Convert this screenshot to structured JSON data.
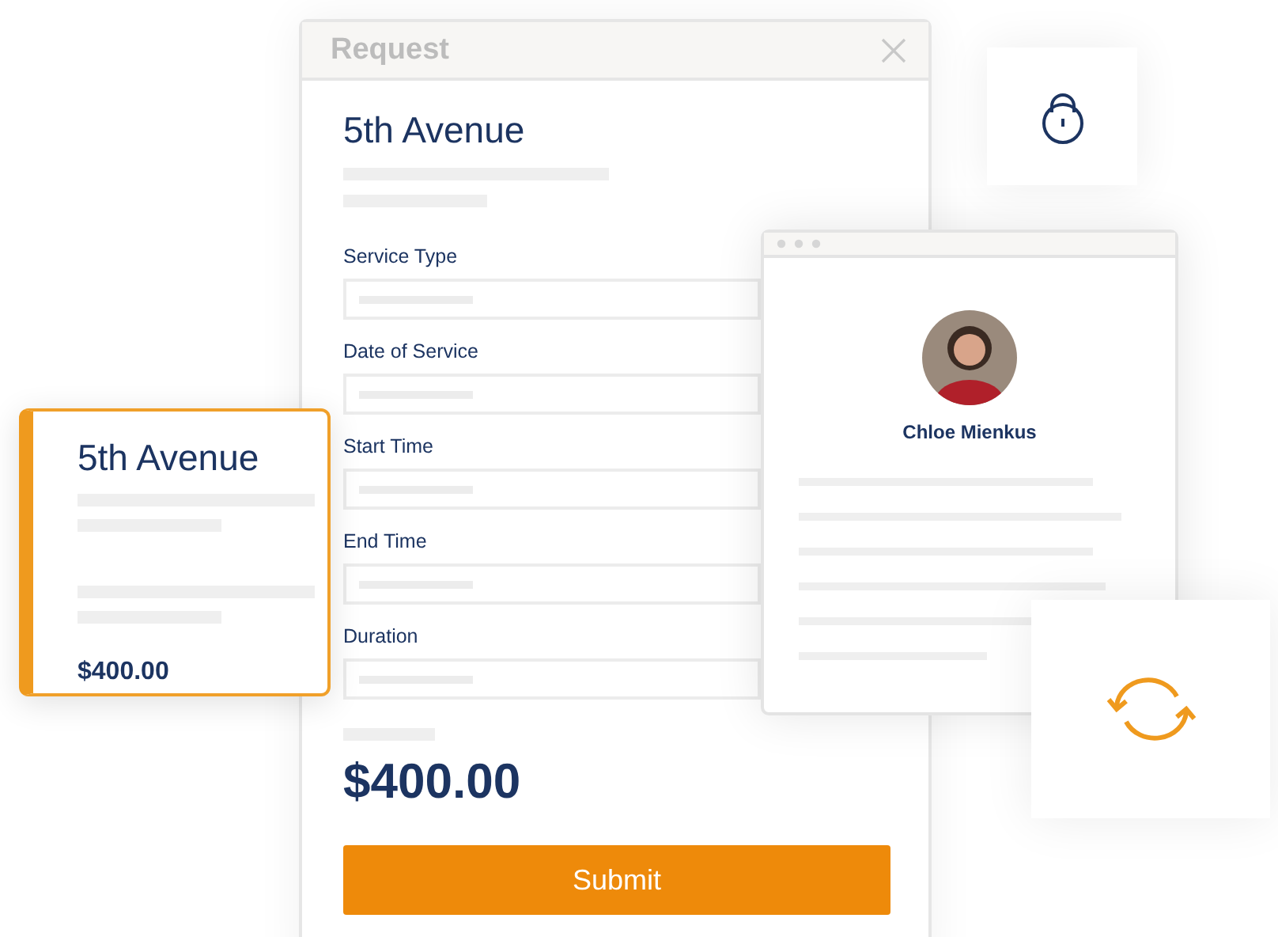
{
  "request_window": {
    "title": "Request",
    "heading": "5th Avenue",
    "fields": [
      {
        "label": "Service Type"
      },
      {
        "label": "Date of Service"
      },
      {
        "label": "Start Time"
      },
      {
        "label": "End Time"
      },
      {
        "label": "Duration"
      }
    ],
    "total": "$400.00",
    "submit": "Submit"
  },
  "summary_card": {
    "title": "5th Avenue",
    "price": "$400.00"
  },
  "profile_window": {
    "name": "Chloe Mienkus"
  }
}
